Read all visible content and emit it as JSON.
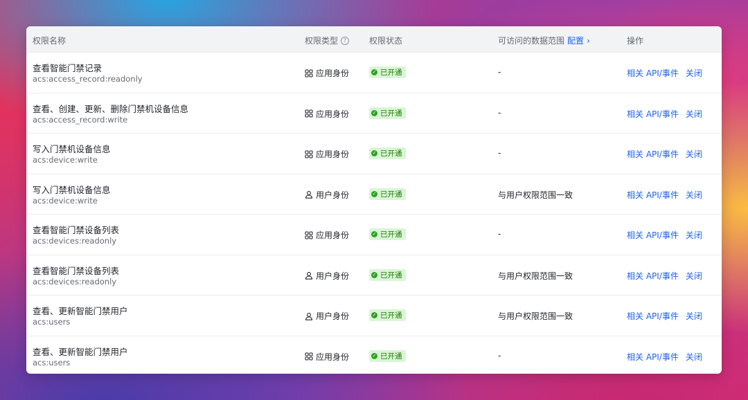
{
  "header": {
    "name": "权限名称",
    "type": "权限类型",
    "status": "权限状态",
    "scope": "可访问的数据范围",
    "scope_config": "配置",
    "ops": "操作"
  },
  "rows": [
    {
      "title": "查看智能门禁记录",
      "code": "acs:access_record:readonly",
      "type_icon": "grid-icon",
      "type": "应用身份",
      "status": "已开通",
      "scope": "-",
      "op_api": "相关 API/事件",
      "op_close": "关闭"
    },
    {
      "title": "查看、创建、更新、删除门禁机设备信息",
      "code": "acs:access_record:write",
      "type_icon": "grid-icon",
      "type": "应用身份",
      "status": "已开通",
      "scope": "-",
      "op_api": "相关 API/事件",
      "op_close": "关闭"
    },
    {
      "title": "写入门禁机设备信息",
      "code": "acs:device:write",
      "type_icon": "grid-icon",
      "type": "应用身份",
      "status": "已开通",
      "scope": "-",
      "op_api": "相关 API/事件",
      "op_close": "关闭"
    },
    {
      "title": "写入门禁机设备信息",
      "code": "acs:device:write",
      "type_icon": "user-icon",
      "type": "用户身份",
      "status": "已开通",
      "scope": "与用户权限范围一致",
      "op_api": "相关 API/事件",
      "op_close": "关闭"
    },
    {
      "title": "查看智能门禁设备列表",
      "code": "acs:devices:readonly",
      "type_icon": "grid-icon",
      "type": "应用身份",
      "status": "已开通",
      "scope": "-",
      "op_api": "相关 API/事件",
      "op_close": "关闭"
    },
    {
      "title": "查看智能门禁设备列表",
      "code": "acs:devices:readonly",
      "type_icon": "user-icon",
      "type": "用户身份",
      "status": "已开通",
      "scope": "与用户权限范围一致",
      "op_api": "相关 API/事件",
      "op_close": "关闭"
    },
    {
      "title": "查看、更新智能门禁用户",
      "code": "acs:users",
      "type_icon": "user-icon",
      "type": "用户身份",
      "status": "已开通",
      "scope": "与用户权限范围一致",
      "op_api": "相关 API/事件",
      "op_close": "关闭"
    },
    {
      "title": "查看、更新智能门禁用户",
      "code": "acs:users",
      "type_icon": "grid-icon",
      "type": "应用身份",
      "status": "已开通",
      "scope": "-",
      "op_api": "相关 API/事件",
      "op_close": "关闭"
    }
  ],
  "colors": {
    "link": "#1f62e8",
    "status_bg": "#d9f5d6",
    "status_text": "#237804"
  }
}
